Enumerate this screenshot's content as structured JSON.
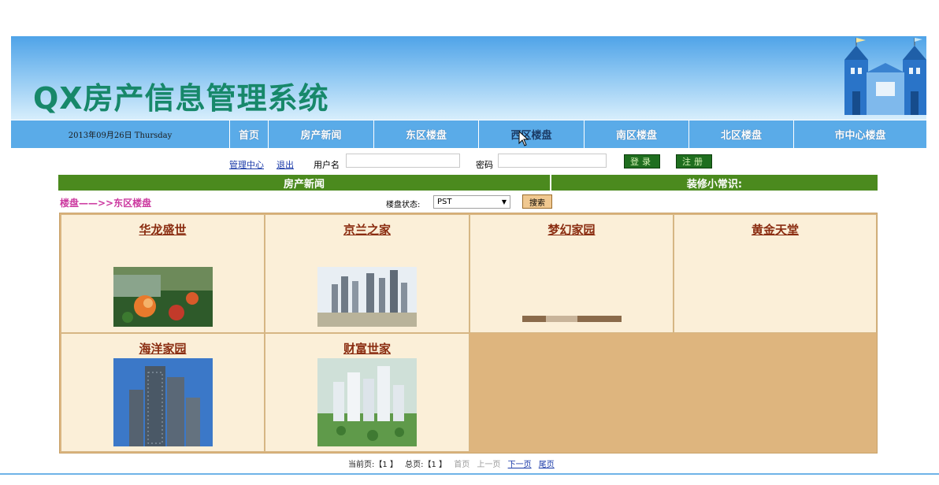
{
  "header": {
    "site_title": "QX房产信息管理系统"
  },
  "nav": {
    "date": "2013年09月26日 Thursday",
    "items": [
      {
        "label": "首页"
      },
      {
        "label": "房产新闻"
      },
      {
        "label": "东区楼盘"
      },
      {
        "label": "西区楼盘"
      },
      {
        "label": "南区楼盘"
      },
      {
        "label": "北区楼盘"
      },
      {
        "label": "市中心楼盘"
      }
    ]
  },
  "login": {
    "admin_link": "管理中心",
    "logout_link": "退出",
    "username_label": "用户名",
    "username_value": "",
    "password_label": "密码",
    "password_value": "",
    "login_button": "登录",
    "register_button": "注册"
  },
  "sections": {
    "news_header": "房产新闻",
    "tips_header": "装修小常识:"
  },
  "listing": {
    "breadcrumb": "楼盘——>>东区楼盘",
    "status_label": "楼盘状态:",
    "status_selected": "PST",
    "search_button": "搜索",
    "properties": [
      {
        "name": "华龙盛世",
        "image": "flower-garden-photo"
      },
      {
        "name": "京兰之家",
        "image": "skyline-towers-photo"
      },
      {
        "name": "梦幻家园",
        "image": "partial-broken-photo"
      },
      {
        "name": "黄金天堂",
        "image": ""
      },
      {
        "name": "海洋家园",
        "image": "highrise-blue-sky-photo"
      },
      {
        "name": "财富世家",
        "image": "aerial-complex-photo"
      }
    ]
  },
  "pager": {
    "current_label": "当前页:",
    "current_value": "【1 】",
    "total_label": "总页:",
    "total_value": "【1 】",
    "first": "首页",
    "prev": "上一页",
    "next": "下一页",
    "last": "尾页"
  },
  "colors": {
    "title_green": "#17886a",
    "nav_blue": "#5aabe8",
    "section_green": "#4b8a1e",
    "card_bg": "#fbefd8",
    "grid_bg": "#deb57e"
  }
}
